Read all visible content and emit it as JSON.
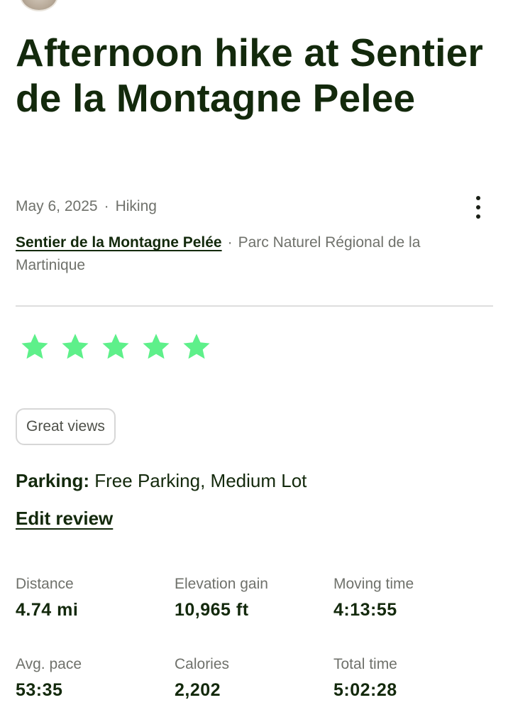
{
  "activity": {
    "title": "Afternoon hike at Sentier de la Montagne Pelee",
    "date": "May 6, 2025",
    "separator": "·",
    "type": "Hiking",
    "trail_link": "Sentier de la Montagne Pelée",
    "park": "Parc Naturel Régional de la Martinique"
  },
  "review": {
    "rating": 5,
    "max_rating": 5,
    "star_color": "#5ef08a",
    "tag": "Great views",
    "parking_label": "Parking:",
    "parking_value": "Free Parking, Medium Lot",
    "edit_label": "Edit review"
  },
  "stats": [
    {
      "label": "Distance",
      "value": "4.74 mi"
    },
    {
      "label": "Elevation gain",
      "value": "10,965 ft"
    },
    {
      "label": "Moving time",
      "value": "4:13:55"
    },
    {
      "label": "Avg. pace",
      "value": "53:35"
    },
    {
      "label": "Calories",
      "value": "2,202"
    },
    {
      "label": "Total time",
      "value": "5:02:28"
    }
  ],
  "icons": {
    "more": "more-vertical-icon",
    "star": "star-icon"
  }
}
